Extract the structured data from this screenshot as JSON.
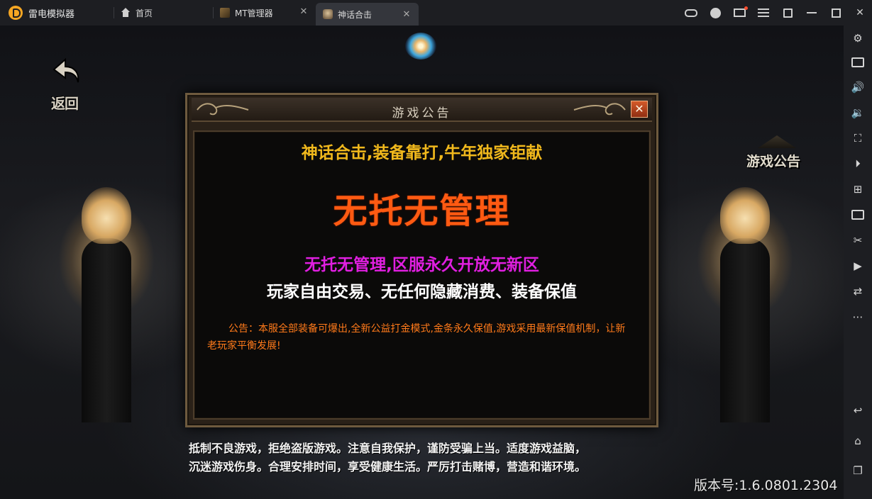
{
  "app": {
    "title": "雷电模拟器"
  },
  "tabs": [
    {
      "label": "首页",
      "icon": "home-icon",
      "active": false
    },
    {
      "label": "MT管理器",
      "icon": "mt-manager-icon",
      "active": false,
      "close": "✕"
    },
    {
      "label": "神话合击",
      "icon": "game-icon",
      "active": true,
      "close": "✕"
    }
  ],
  "window_controls": [
    "gamepad-icon",
    "user-icon",
    "mail-icon",
    "menu-icon",
    "shrink-icon",
    "minimize-icon",
    "maximize-icon",
    "close-icon"
  ],
  "sidebar": [
    "settings-icon",
    "keyboard-icon",
    "volume-up-icon",
    "volume-down-icon",
    "screen-resolution-icon",
    "play-record-icon",
    "multi-instance-icon",
    "apk-install-icon",
    "screenshot-scissors-icon",
    "video-icon",
    "sync-icon",
    "more-icon",
    "back-nav-icon",
    "home-nav-icon",
    "recent-apps-icon"
  ],
  "game": {
    "back_label": "返回",
    "notice_label": "游戏公告",
    "dialog": {
      "title": "游戏公告",
      "close": "✕",
      "line1": "神话合击,装备靠打,牛年独家钜献",
      "line2": "无托无管理",
      "line3": "无托无管理,区服永久开放无新区",
      "line4": "玩家自由交易、无任何隐藏消费、装备保值",
      "line5": "公告：本服全部装备可爆出,全新公益打金模式,金条永久保值,游戏采用最新保值机制，让新老玩家平衡发展!"
    },
    "warning_line1": "抵制不良游戏，拒绝盗版游戏。注意自我保护，谨防受骗上当。适度游戏益脑，",
    "warning_line2": "沉迷游戏伤身。合理安排时间，享受健康生活。严厉打击赌博，营造和谐环境。",
    "version": "版本号:1.6.0801.2304"
  },
  "colors": {
    "titlebar": "#1d1e22",
    "accent_orange": "#ff5a12",
    "headline_gold": "#f0b81c",
    "magenta": "#e01fe0"
  }
}
